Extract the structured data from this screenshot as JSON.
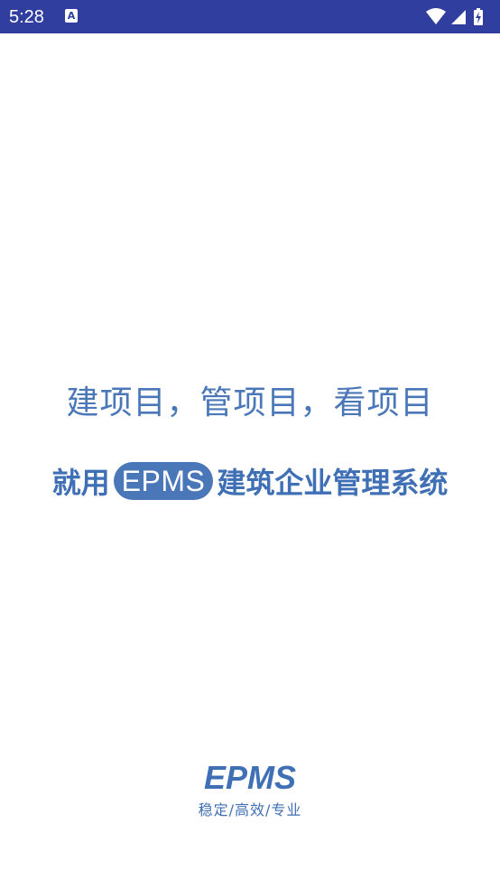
{
  "status_bar": {
    "time": "5:28",
    "notification_icon": "A",
    "icons": [
      "wifi-icon",
      "signal-icon",
      "battery-charging-icon"
    ],
    "background_color": "#303f9f"
  },
  "splash": {
    "slogan_line1": "建项目，管项目，看项目",
    "slogan_line2_prefix": "就用",
    "slogan_line2_highlight": "EPMS",
    "slogan_line2_suffix": "建筑企业管理系统",
    "brand_logo_text": "EPMS",
    "brand_tagline": "稳定/高效/专业",
    "accent_color": "#4a77b8"
  }
}
